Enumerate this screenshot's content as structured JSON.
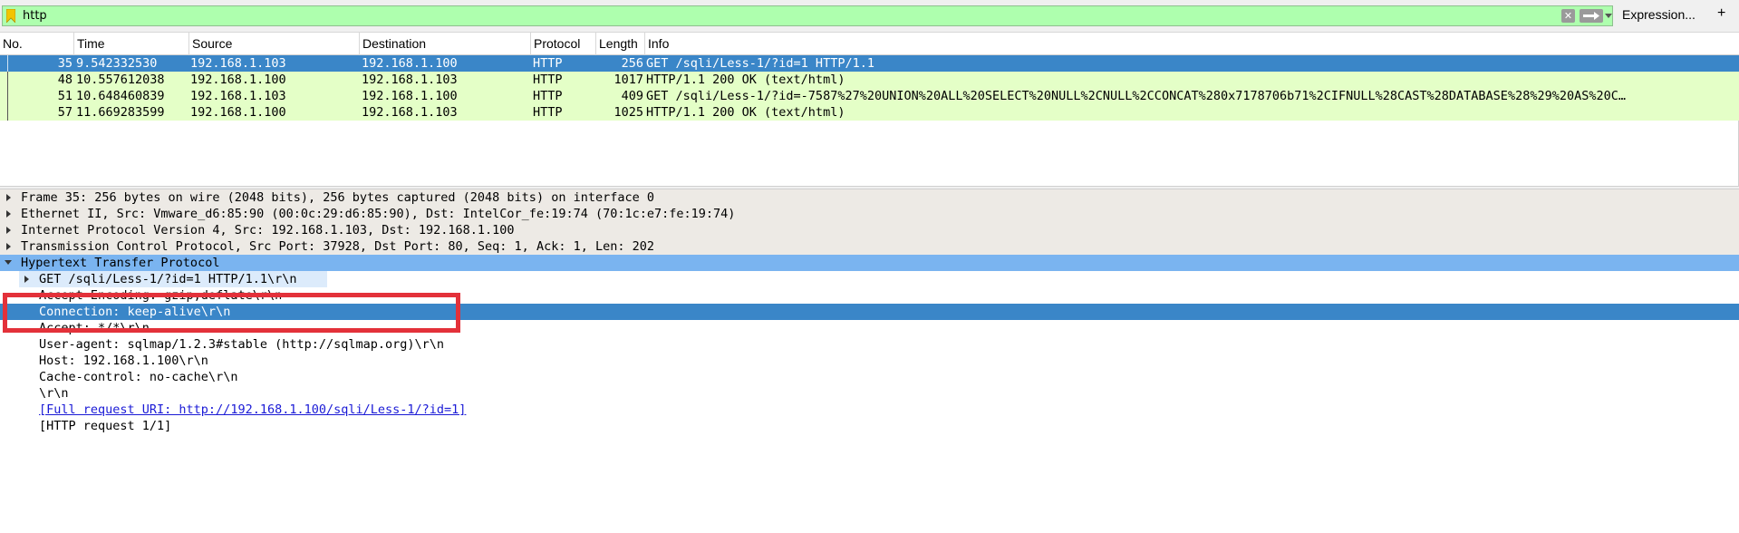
{
  "filter": {
    "value": "http",
    "expression_label": "Expression...",
    "plus_label": "+",
    "clear_icon": "clear-icon",
    "apply_icon": "apply-arrow-icon",
    "bookmark_icon": "bookmark-icon"
  },
  "packet_list": {
    "columns": [
      "No.",
      "Time",
      "Source",
      "Destination",
      "Protocol",
      "Length",
      "Info"
    ],
    "rows": [
      {
        "no": "35",
        "time": "9.542332530",
        "source": "192.168.1.103",
        "destination": "192.168.1.100",
        "protocol": "HTTP",
        "length": "256",
        "info": "GET /sqli/Less-1/?id=1 HTTP/1.1",
        "selected": true
      },
      {
        "no": "48",
        "time": "10.557612038",
        "source": "192.168.1.100",
        "destination": "192.168.1.103",
        "protocol": "HTTP",
        "length": "1017",
        "info": "HTTP/1.1 200 OK  (text/html)",
        "selected": false
      },
      {
        "no": "51",
        "time": "10.648460839",
        "source": "192.168.1.103",
        "destination": "192.168.1.100",
        "protocol": "HTTP",
        "length": "409",
        "info": "GET /sqli/Less-1/?id=-7587%27%20UNION%20ALL%20SELECT%20NULL%2CNULL%2CCONCAT%280x7178706b71%2CIFNULL%28CAST%28DATABASE%28%29%20AS%20C…",
        "selected": false
      },
      {
        "no": "57",
        "time": "11.669283599",
        "source": "192.168.1.100",
        "destination": "192.168.1.103",
        "protocol": "HTTP",
        "length": "1025",
        "info": "HTTP/1.1 200 OK  (text/html)",
        "selected": false
      }
    ]
  },
  "details": {
    "frame": "Frame 35: 256 bytes on wire (2048 bits), 256 bytes captured (2048 bits) on interface 0",
    "ethernet": "Ethernet II, Src: Vmware_d6:85:90 (00:0c:29:d6:85:90), Dst: IntelCor_fe:19:74 (70:1c:e7:fe:19:74)",
    "ip": "Internet Protocol Version 4, Src: 192.168.1.103, Dst: 192.168.1.100",
    "tcp": "Transmission Control Protocol, Src Port: 37928, Dst Port: 80, Seq: 1, Ack: 1, Len: 202",
    "http": "Hypertext Transfer Protocol",
    "http_fields": {
      "request_line": "GET /sqli/Less-1/?id=1 HTTP/1.1\\r\\n",
      "accept_encoding": "Accept-Encoding: gzip,deflate\\r\\n",
      "connection": "Connection: keep-alive\\r\\n",
      "accept": "Accept: */*\\r\\n",
      "user_agent": "User-agent: sqlmap/1.2.3#stable (http://sqlmap.org)\\r\\n",
      "host": "Host: 192.168.1.100\\r\\n",
      "cache_control": "Cache-control: no-cache\\r\\n",
      "crlf": "\\r\\n",
      "full_uri": "[Full request URI: http://192.168.1.100/sqli/Less-1/?id=1]",
      "request_count": "[HTTP request 1/1]"
    }
  },
  "colors": {
    "filter_valid": "#aeffae",
    "selection": "#3a86c8",
    "http_row": "#e4ffc7",
    "section_selected": "#7ab4f0",
    "annotation_box": "#e3313a"
  }
}
